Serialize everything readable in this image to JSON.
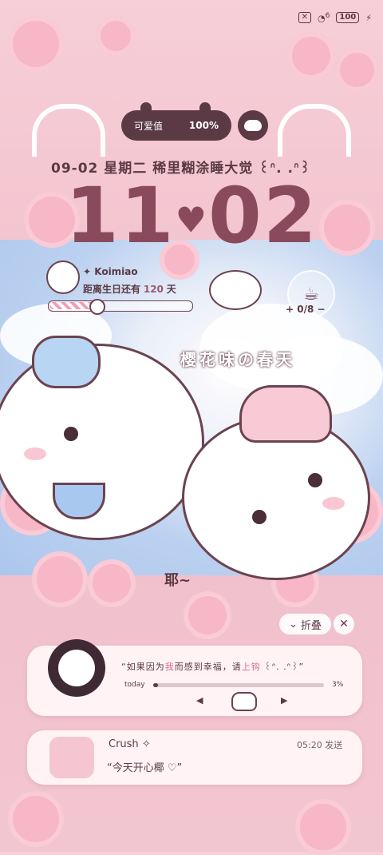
{
  "status_bar": {
    "sim_icon": "sim-off-icon",
    "wifi_icon": "wifi-icon",
    "wifi_label": "6",
    "battery": "100",
    "charging_icon": "bolt-icon"
  },
  "widget": {
    "cuteness_label": "可爱值",
    "cuteness_value": "100%",
    "date_line": "09-02 星期二  稀里糊涂睡大觉 ꒰ᐢ. .ᐢ꒱",
    "hour": "11",
    "minute": "02",
    "user_name": "Koimiao",
    "birthday_text_prefix": "距离生日还有",
    "birthday_days": "120",
    "birthday_text_suffix": "天",
    "birthday_progress": 0.33,
    "cup_count": "0/8",
    "slogan": "樱花味の春天",
    "caption": "耶~"
  },
  "notifications": {
    "collapse_label": "折叠",
    "music": {
      "quote_start": "“如果因为",
      "quote_hl1": "我",
      "quote_mid": "而感到幸福，请",
      "quote_hl2": "上钩",
      "quote_end": " ꒰ᐢ. .ᐢ꒱”",
      "progress_label": "today",
      "progress_value": "3%",
      "progress": 0.03
    },
    "message": {
      "name": "Crush",
      "time": "05:20 发送",
      "text": "“今天开心椰 ♡”"
    }
  },
  "colors": {
    "accent": "#5b3a45",
    "clock": "#8a4a5e",
    "highlight": "#d86a8c"
  }
}
